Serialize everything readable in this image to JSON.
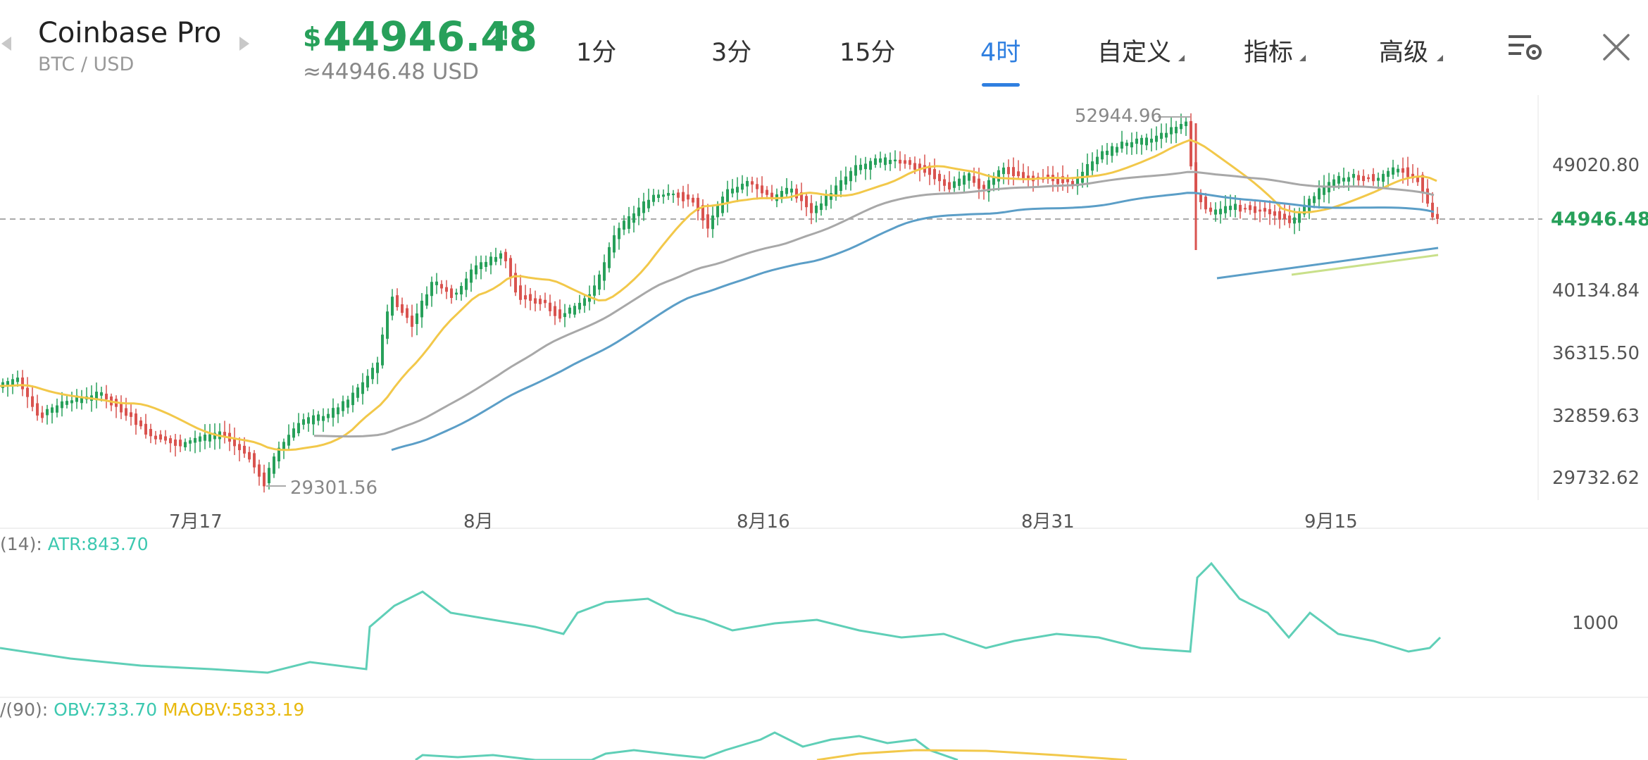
{
  "header": {
    "exchange": "Coinbase Pro",
    "pair": "BTC / USD",
    "currency_symbol": "$",
    "price": "44946.48",
    "price_usd": "≈44946.48 USD",
    "price_color": "#27a05a"
  },
  "tabs": [
    {
      "label": "1分",
      "active": false
    },
    {
      "label": "3分",
      "active": false
    },
    {
      "label": "15分",
      "active": false
    },
    {
      "label": "4时",
      "active": true
    },
    {
      "label": "自定义",
      "active": false,
      "dropdown": true
    },
    {
      "label": "指标",
      "active": false,
      "dropdown": true
    },
    {
      "label": "高级",
      "active": false,
      "dropdown": true
    }
  ],
  "icons": {
    "prev": "chevron-left-icon",
    "next": "chevron-right-icon",
    "trend": "arrow-up-right-icon",
    "settings": "chart-settings-icon",
    "close": "close-icon"
  },
  "accent_color": "#2f7fe0",
  "main_chart": {
    "y_axis_labels": [
      "49020.80",
      "40134.84",
      "36315.50",
      "32859.63",
      "29732.62"
    ],
    "last_price_label": "44946.48",
    "high_label": "52944.96",
    "low_label": "29301.56",
    "x_axis_labels": [
      "7月17",
      "8月",
      "8月16",
      "8月31",
      "9月15"
    ]
  },
  "atr": {
    "prefix": "(14):",
    "label": "ATR:843.70",
    "axis_label": "1000",
    "color": "#3cc8b0"
  },
  "obv": {
    "prefix": "/(90):",
    "obv_label": "OBV:733.70",
    "maobv_label": "MAOBV:5833.19",
    "obv_color": "#3cc8b0",
    "maobv_color": "#e8b90e"
  }
}
